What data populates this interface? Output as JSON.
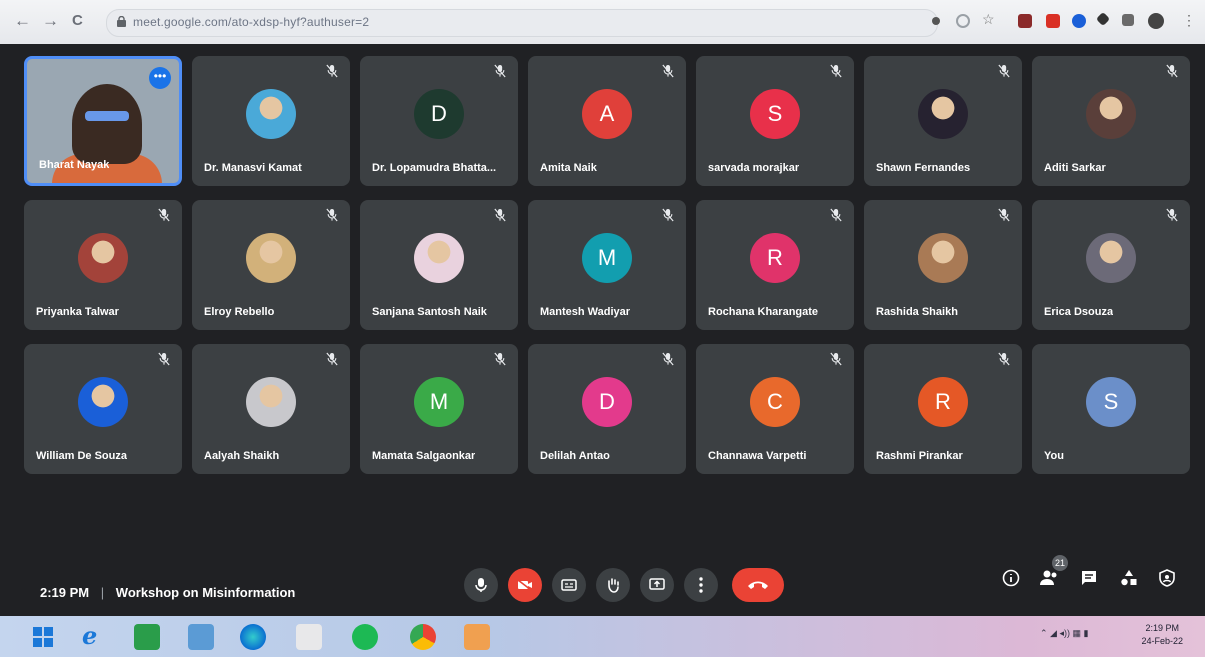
{
  "browser": {
    "url": "meet.google.com/ato-xdsp-hyf?authuser=2",
    "nav_back": "←",
    "nav_forward": "→",
    "nav_reload": "C"
  },
  "participants": [
    {
      "name": "Bharat Nayak",
      "type": "video",
      "color": "#8fa3b3"
    },
    {
      "name": "Dr. Manasvi Kamat",
      "type": "photo",
      "color": "#4aa9d8"
    },
    {
      "name": "Dr. Lopamudra Bhatta...",
      "type": "initial",
      "initial": "D",
      "color": "#1e3a2f"
    },
    {
      "name": "Amita Naik",
      "type": "initial",
      "initial": "A",
      "color": "#e0403a"
    },
    {
      "name": "sarvada morajkar",
      "type": "initial",
      "initial": "S",
      "color": "#e8304a"
    },
    {
      "name": "Shawn Fernandes",
      "type": "photo",
      "color": "#262230"
    },
    {
      "name": "Aditi Sarkar",
      "type": "photo",
      "color": "#5a3f3a"
    },
    {
      "name": "Priyanka Talwar",
      "type": "photo",
      "color": "#a3433a"
    },
    {
      "name": "Elroy Rebello",
      "type": "photo",
      "color": "#d2b17a"
    },
    {
      "name": "Sanjana Santosh Naik",
      "type": "photo",
      "color": "#e9d2de"
    },
    {
      "name": "Mantesh Wadiyar",
      "type": "initial",
      "initial": "M",
      "color": "#129eaf"
    },
    {
      "name": "Rochana Kharangate",
      "type": "initial",
      "initial": "R",
      "color": "#e0336a"
    },
    {
      "name": "Rashida Shaikh",
      "type": "photo",
      "color": "#a97a55"
    },
    {
      "name": "Erica Dsouza",
      "type": "photo",
      "color": "#6c6a78"
    },
    {
      "name": "William De Souza",
      "type": "photo",
      "color": "#1a5fd8"
    },
    {
      "name": "Aalyah Shaikh",
      "type": "photo",
      "color": "#c8c8cc"
    },
    {
      "name": "Mamata Salgaonkar",
      "type": "initial",
      "initial": "M",
      "color": "#3aaa48"
    },
    {
      "name": "Delilah Antao",
      "type": "initial",
      "initial": "D",
      "color": "#e33a8c"
    },
    {
      "name": "Channawa Varpetti",
      "type": "initial",
      "initial": "C",
      "color": "#e8692c"
    },
    {
      "name": "Rashmi Pirankar",
      "type": "initial",
      "initial": "R",
      "color": "#e55826"
    },
    {
      "name": "You",
      "type": "initial",
      "initial": "S",
      "color": "#6b8fc9"
    }
  ],
  "meeting": {
    "time": "2:19 PM",
    "separator": "|",
    "title": "Workshop on Misinformation"
  },
  "people_count": "21",
  "controls": {
    "more_dot": "•••"
  },
  "taskbar": {
    "clock_time": "2:19 PM",
    "clock_date": "24-Feb-22"
  },
  "colors": {
    "stage_bg": "#202124",
    "tile_bg": "#3c4043",
    "accent": "#1a73e8",
    "danger": "#ea4335"
  }
}
